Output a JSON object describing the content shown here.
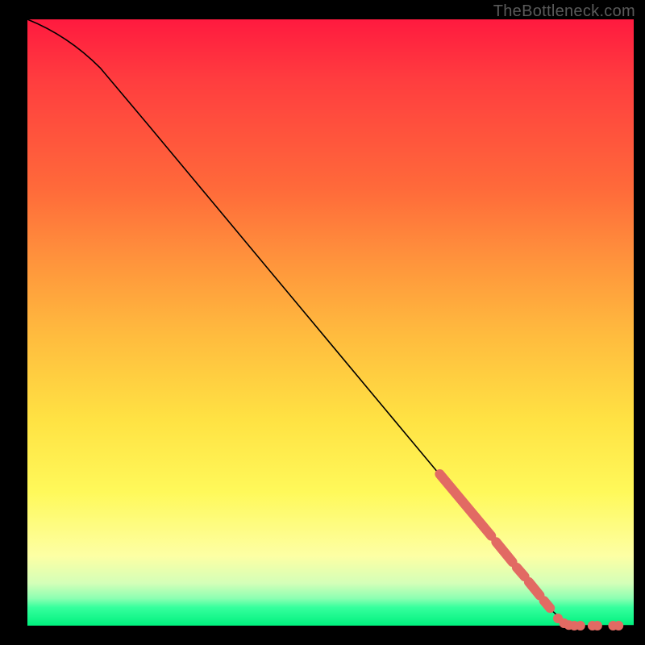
{
  "watermark": "TheBottleneck.com",
  "colors": {
    "curve_stroke": "#000000",
    "marker_fill": "#e26a63",
    "marker_stroke": "#e26a63"
  },
  "chart_data": {
    "type": "line",
    "title": "",
    "xlabel": "",
    "ylabel": "",
    "xlim": [
      0,
      100
    ],
    "ylim": [
      0,
      100
    ],
    "curve": [
      {
        "x": 0,
        "y": 100
      },
      {
        "x": 5,
        "y": 98
      },
      {
        "x": 9,
        "y": 95
      },
      {
        "x": 12,
        "y": 92
      },
      {
        "x": 20,
        "y": 82.5
      },
      {
        "x": 30,
        "y": 70.5
      },
      {
        "x": 40,
        "y": 58.5
      },
      {
        "x": 50,
        "y": 46.5
      },
      {
        "x": 60,
        "y": 34.5
      },
      {
        "x": 70,
        "y": 22.5
      },
      {
        "x": 80,
        "y": 10.5
      },
      {
        "x": 86,
        "y": 3
      },
      {
        "x": 88.5,
        "y": 0.5
      },
      {
        "x": 90,
        "y": 0
      },
      {
        "x": 100,
        "y": 0
      }
    ],
    "marker_segments": [
      {
        "from": {
          "x": 68,
          "y": 25
        },
        "to": {
          "x": 76.5,
          "y": 14.8
        }
      },
      {
        "from": {
          "x": 77.3,
          "y": 13.8
        },
        "to": {
          "x": 80,
          "y": 10.5
        }
      },
      {
        "from": {
          "x": 80.7,
          "y": 9.6
        },
        "to": {
          "x": 82,
          "y": 8.1
        }
      },
      {
        "from": {
          "x": 82.7,
          "y": 7.2
        },
        "to": {
          "x": 84.5,
          "y": 5
        }
      },
      {
        "from": {
          "x": 85.2,
          "y": 4.1
        },
        "to": {
          "x": 86.2,
          "y": 2.9
        }
      }
    ],
    "marker_points": [
      {
        "x": 87.5,
        "y": 1.2
      },
      {
        "x": 88.5,
        "y": 0.4
      },
      {
        "x": 89.3,
        "y": 0.1
      },
      {
        "x": 90.2,
        "y": 0
      },
      {
        "x": 91.2,
        "y": 0
      },
      {
        "x": 93.2,
        "y": 0
      },
      {
        "x": 94.0,
        "y": 0
      },
      {
        "x": 96.6,
        "y": 0
      },
      {
        "x": 97.5,
        "y": 0
      }
    ]
  }
}
